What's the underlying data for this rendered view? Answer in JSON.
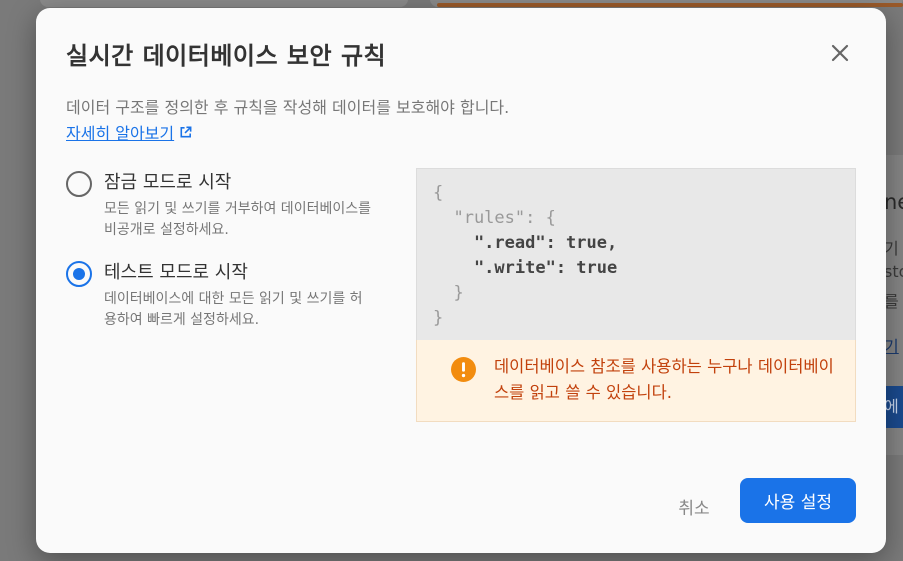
{
  "background": {
    "peek_lines": [
      "ne",
      "기",
      "sto",
      "를",
      "기"
    ],
    "peek_button": "에"
  },
  "dialog": {
    "title": "실시간 데이터베이스 보안 규칙",
    "close_icon": "close-icon",
    "description": "데이터 구조를 정의한 후 규칙을 작성해 데이터를 보호해야 합니다.",
    "learn_more": "자세히 알아보기",
    "options": [
      {
        "label": "잠금 모드로 시작",
        "description": "모든 읽기 및 쓰기를 거부하여 데이터베이스를 비공개로 설정하세요.",
        "selected": false
      },
      {
        "label": "테스트 모드로 시작",
        "description": "데이터베이스에 대한 모든 읽기 및 쓰기를 허용하여 빠르게 설정하세요.",
        "selected": true
      }
    ],
    "code": {
      "line1": "{",
      "line2_key": "  \"rules\"",
      "line2_rest": ": {",
      "line3": "    \".read\": true,",
      "line4": "    \".write\": true",
      "line5": "  }",
      "line6": "}"
    },
    "warning": {
      "icon": "warning-icon",
      "text": "데이터베이스 참조를 사용하는 누구나 데이터베이스를 읽고 쓸 수 있습니다."
    },
    "buttons": {
      "cancel": "취소",
      "confirm": "사용 설정"
    }
  },
  "colors": {
    "accent": "#1a73e8",
    "warning_text": "#c2410c",
    "warning_icon": "#f28c0f",
    "warning_bg": "#fff3e2"
  }
}
